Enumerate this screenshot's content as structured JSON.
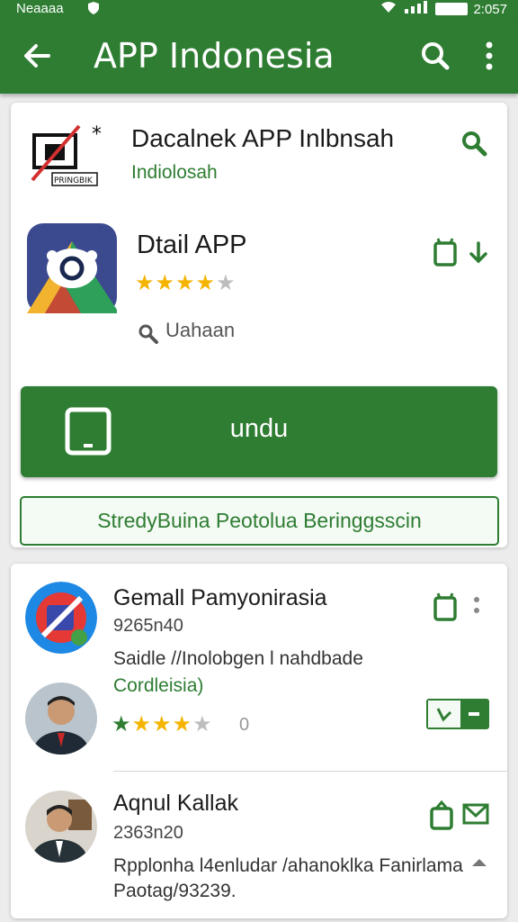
{
  "status_bar": {
    "left_text": "Neaaaa",
    "time": "2:057"
  },
  "app_bar": {
    "title": "APP Indonesia"
  },
  "developer": {
    "name": "Dacalnek APP Inlbnsah",
    "subtitle": "Indiolosah",
    "logo_text": "PRINGBIK"
  },
  "app": {
    "name": "Dtail APP",
    "rating": 4,
    "rating_max": 5,
    "search_label": "Uahaan",
    "install_label": "undu",
    "secondary_label": "StredyBuina  Peotolua Beringgsscin"
  },
  "reviews": [
    {
      "title": "Gemall Pamyonirasia",
      "meta": "9265n40",
      "text": "Saidle //Inolobgen l nahdbade",
      "text2": "Cordleisia)",
      "rating": 4,
      "rating_count": "0"
    },
    {
      "title": "Aqnul Kallak",
      "meta": "2363n20",
      "text": "Rpplonha l4enludar /ahanoklka Fanirlama",
      "text2": "Paotag/93239."
    }
  ],
  "colors": {
    "primary": "#2e7d32",
    "star": "#f4b400",
    "star_off": "#bdbdbd"
  }
}
